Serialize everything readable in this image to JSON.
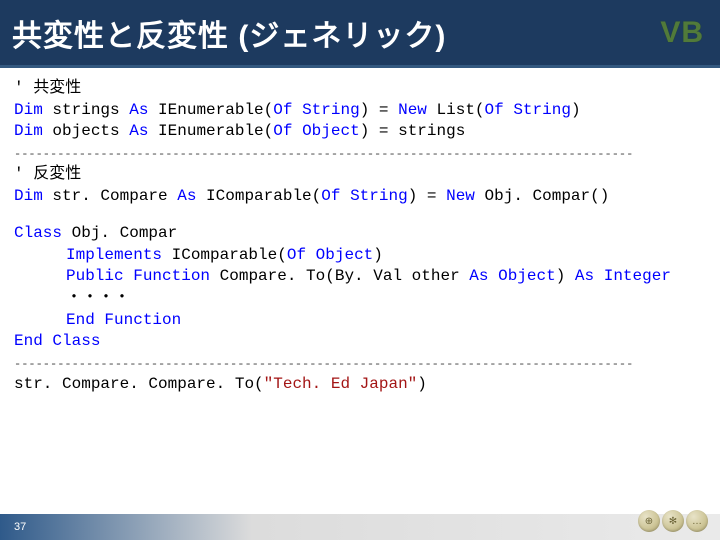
{
  "header": {
    "title": "共変性と反変性 (ジェネリック)",
    "badge": "VB"
  },
  "code": {
    "c01": "' 共変性",
    "c02a": "Dim",
    "c02b": " strings ",
    "c02c": "As",
    "c02d": " IEnumerable(",
    "c02e": "Of",
    "c02f": " ",
    "c02g": "String",
    "c02h": ") = ",
    "c02i": "New",
    "c02j": " List(",
    "c02k": "Of",
    "c02l": " ",
    "c02m": "String",
    "c02n": ")",
    "c03a": "Dim",
    "c03b": " objects ",
    "c03c": "As",
    "c03d": " IEnumerable(",
    "c03e": "Of",
    "c03f": " ",
    "c03g": "Object",
    "c03h": ") = strings",
    "sep1": "--------------------------------------------------------------------------------------",
    "c04": "' 反変性",
    "c05a": "Dim",
    "c05b": " str. Compare ",
    "c05c": "As",
    "c05d": " IComparable(",
    "c05e": "Of",
    "c05f": " ",
    "c05g": "String",
    "c05h": ") = ",
    "c05i": "New",
    "c05j": " Obj. Compar()",
    "c06a": "Class",
    "c06b": " Obj. Compar",
    "c07a": "Implements",
    "c07b": " IComparable(",
    "c07c": "Of",
    "c07d": " ",
    "c07e": "Object",
    "c07f": ")",
    "c08a": "Public",
    "c08b": " ",
    "c08c": "Function",
    "c08d": " Compare. To(By. Val other ",
    "c08e": "As",
    "c08f": " ",
    "c08g": "Object",
    "c08h": ") ",
    "c08i": "As",
    "c08j": " ",
    "c08k": "Integer",
    "c09": "・・・・",
    "c10a": "End",
    "c10b": " ",
    "c10c": "Function",
    "c11a": "End",
    "c11b": " ",
    "c11c": "Class",
    "sep2": "--------------------------------------------------------------------------------------",
    "c12a": "str. Compare. Compare. To(",
    "c12b": "\"Tech. Ed Japan\"",
    "c12c": ")"
  },
  "footer": {
    "page": "37"
  }
}
